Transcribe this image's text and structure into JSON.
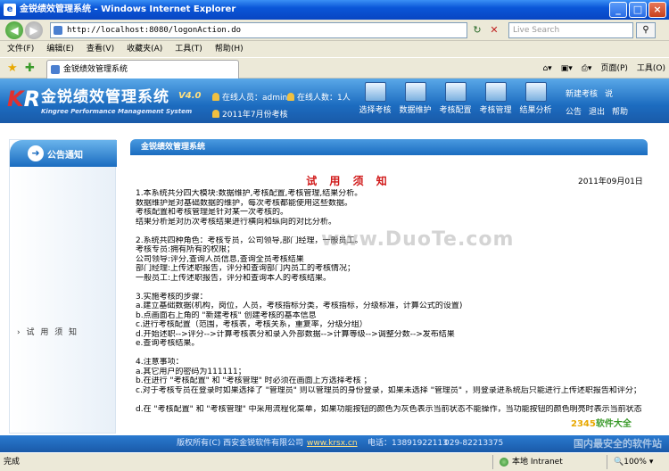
{
  "window": {
    "title": "金锐绩效管理系统 - Windows Internet Explorer"
  },
  "address": {
    "url": "http://localhost:8080/logonAction.do",
    "search_placeholder": "Live Search"
  },
  "menu": [
    "文件(F)",
    "编辑(E)",
    "查看(V)",
    "收藏夹(A)",
    "工具(T)",
    "帮助(H)"
  ],
  "tab": {
    "label": "金锐绩效管理系统"
  },
  "commands": {
    "page": "页面(P)",
    "tools": "工具(O)"
  },
  "app": {
    "logo_title": "金锐绩效管理系统",
    "version": "V4.0",
    "subtitle": "Kingree Performance Management System",
    "online_user": "在线人员：admin",
    "online_count": "在线人数：1人",
    "period": "2011年7月份考核",
    "nav": [
      "选择考核",
      "数据维护",
      "考核配置",
      "考核管理",
      "结果分析"
    ],
    "new_review": "新建考核",
    "notice": "公告",
    "exit": "退出",
    "help": "帮助",
    "more": "说"
  },
  "sidebar": {
    "header": "公告通知",
    "item": "试 用 须 知"
  },
  "panel": {
    "header": "金锐绩效管理系统",
    "title": "试 用 须 知",
    "date": "2011年09月01日",
    "lines": [
      "1.本系统共分四大模块:数据维护,考核配置,考核管理,结果分析。",
      "数据维护是对基础数据的维护，每次考核都能使用这些数据。",
      "考核配置和考核管理是针对某一次考核的。",
      "结果分析是对历次考核结果进行横向和纵向的对比分析。",
      "",
      "2.系统共四种角色：考核专员，公司领导,部门经理，一般员工。",
      "考核专员:拥有所有的权限；",
      "公司领导:评分,查询人员信息,查询全员考核结果",
      "部门经理:上传述职报告，评分和查询部门内员工的考核情况；",
      "一般员工:上传述职报告，评分和查询本人的考核结果。",
      "",
      "3.实施考核的步骤：",
      "a.建立基础数据(机构，岗位，人员，考核指标分类，考核指标，分级标准，计算公式的设置)",
      "b.点画面右上角的 \"新建考核\" 创建考核的基本信息",
      "c.进行考核配置（范围，考核表，考核关系，重复率，分级分组）",
      "d.开始述职-->评分-->计算考核表分和录入外部数据-->计算等级-->调整分数-->发布结果",
      "e.查询考核结果。",
      "",
      "4.注意事项：",
      "a.其它用户的密码为111111；",
      "b.在进行 \"考核配置\" 和 \"考核管理\" 时必须在画面上方选择考核 ；",
      "c.对于考核专员在登录时如果选择了 \"管理员\" 则以管理员的身份登录，如果未选择 \"管理员\" ，则登录进系统后只能进行上传述职报告和评分；",
      "",
      "d.在 \"考核配置\" 和 \"考核管理\" 中采用流程化菜单，如果功能按钮的颜色为灰色表示当前状态不能操作，当功能按钮的颜色明亮时表示当前状态"
    ],
    "watermark": "www.DuoTe.com"
  },
  "footer": {
    "copyright": "版权所有(C) 西安金锐软件有限公司",
    "site": "www.krsx.cn",
    "phone": "电话：13891922113",
    "phone2": "029-82213375",
    "slogan": "国内最安全的软件站"
  },
  "brand": {
    "a": "2345",
    "b": "软件大全"
  },
  "status": {
    "left": "完成",
    "zone": "本地 Intranet",
    "zoom": "100%"
  }
}
